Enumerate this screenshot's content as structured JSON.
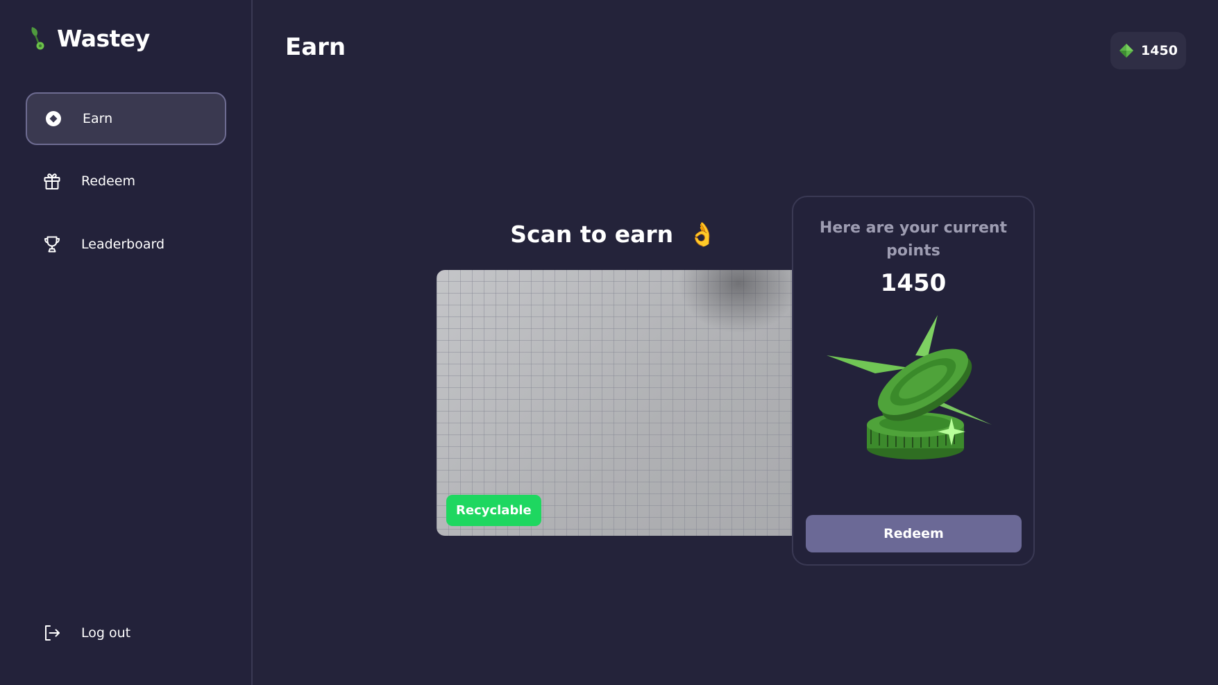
{
  "app": {
    "name": "Wastey"
  },
  "sidebar": {
    "items": [
      {
        "label": "Earn",
        "icon": "earn-icon",
        "active": true
      },
      {
        "label": "Redeem",
        "icon": "gift-icon",
        "active": false
      },
      {
        "label": "Leaderboard",
        "icon": "trophy-icon",
        "active": false
      }
    ],
    "logout_label": "Log out"
  },
  "header": {
    "title": "Earn",
    "points": "1450"
  },
  "scan": {
    "title": "Scan to earn",
    "emoji": "👌",
    "result_badge": "Recyclable"
  },
  "points_card": {
    "heading": "Here are your current points",
    "points": "1450",
    "redeem_label": "Redeem"
  },
  "colors": {
    "background": "#24233a",
    "accent_green": "#1ed760",
    "button_purple": "#6b6996",
    "gem_green": "#5bb548"
  }
}
